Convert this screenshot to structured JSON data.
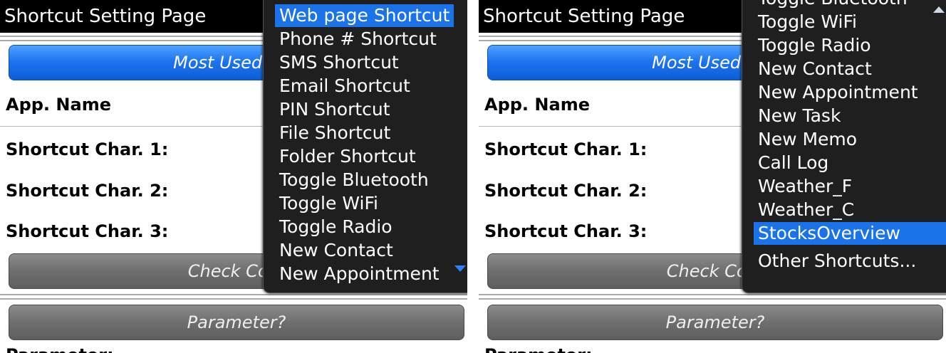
{
  "app": {
    "title": "Shortcut Setting Page",
    "most_used_button": "Most Used Sho",
    "app_name_label": "App. Name",
    "char1_label": "Shortcut Char. 1:",
    "char2_label": "Shortcut Char. 2:",
    "char3_label": "Shortcut Char. 3:",
    "check_button": "Check Conf",
    "parameter_button": "Parameter?",
    "parameter_label": "Parameter:"
  },
  "left_menu": {
    "items": [
      {
        "label": "Web page Shortcut",
        "selected": true
      },
      {
        "label": "Phone # Shortcut",
        "selected": false
      },
      {
        "label": "SMS Shortcut",
        "selected": false
      },
      {
        "label": "Email Shortcut",
        "selected": false
      },
      {
        "label": "PIN Shortcut",
        "selected": false
      },
      {
        "label": "File Shortcut",
        "selected": false
      },
      {
        "label": "Folder Shortcut",
        "selected": false
      },
      {
        "label": "Toggle Bluetooth",
        "selected": false
      },
      {
        "label": "Toggle WiFi",
        "selected": false
      },
      {
        "label": "Toggle Radio",
        "selected": false
      },
      {
        "label": "New Contact",
        "selected": false
      },
      {
        "label": "New Appointment",
        "selected": false
      }
    ],
    "scroll_indicator": "down-arrow-icon"
  },
  "right_menu": {
    "items": [
      {
        "label": "Toggle Bluetooth",
        "selected": false
      },
      {
        "label": "Toggle WiFi",
        "selected": false
      },
      {
        "label": "Toggle Radio",
        "selected": false
      },
      {
        "label": "New Contact",
        "selected": false
      },
      {
        "label": "New Appointment",
        "selected": false
      },
      {
        "label": "New Task",
        "selected": false
      },
      {
        "label": "New Memo",
        "selected": false
      },
      {
        "label": "Call Log",
        "selected": false
      },
      {
        "label": "Weather_F",
        "selected": false
      },
      {
        "label": "Weather_C",
        "selected": false
      },
      {
        "label": "StocksOverview",
        "selected": true
      },
      {
        "label": "Other Shortcuts...",
        "selected": false
      }
    ],
    "scroll_indicator": "up-arrow-icon"
  },
  "colors": {
    "highlight": "#1a73e8",
    "primary_button": "#1d73f0",
    "secondary_button": "#6e6e6e",
    "menu_background": "#1f1f1f"
  }
}
